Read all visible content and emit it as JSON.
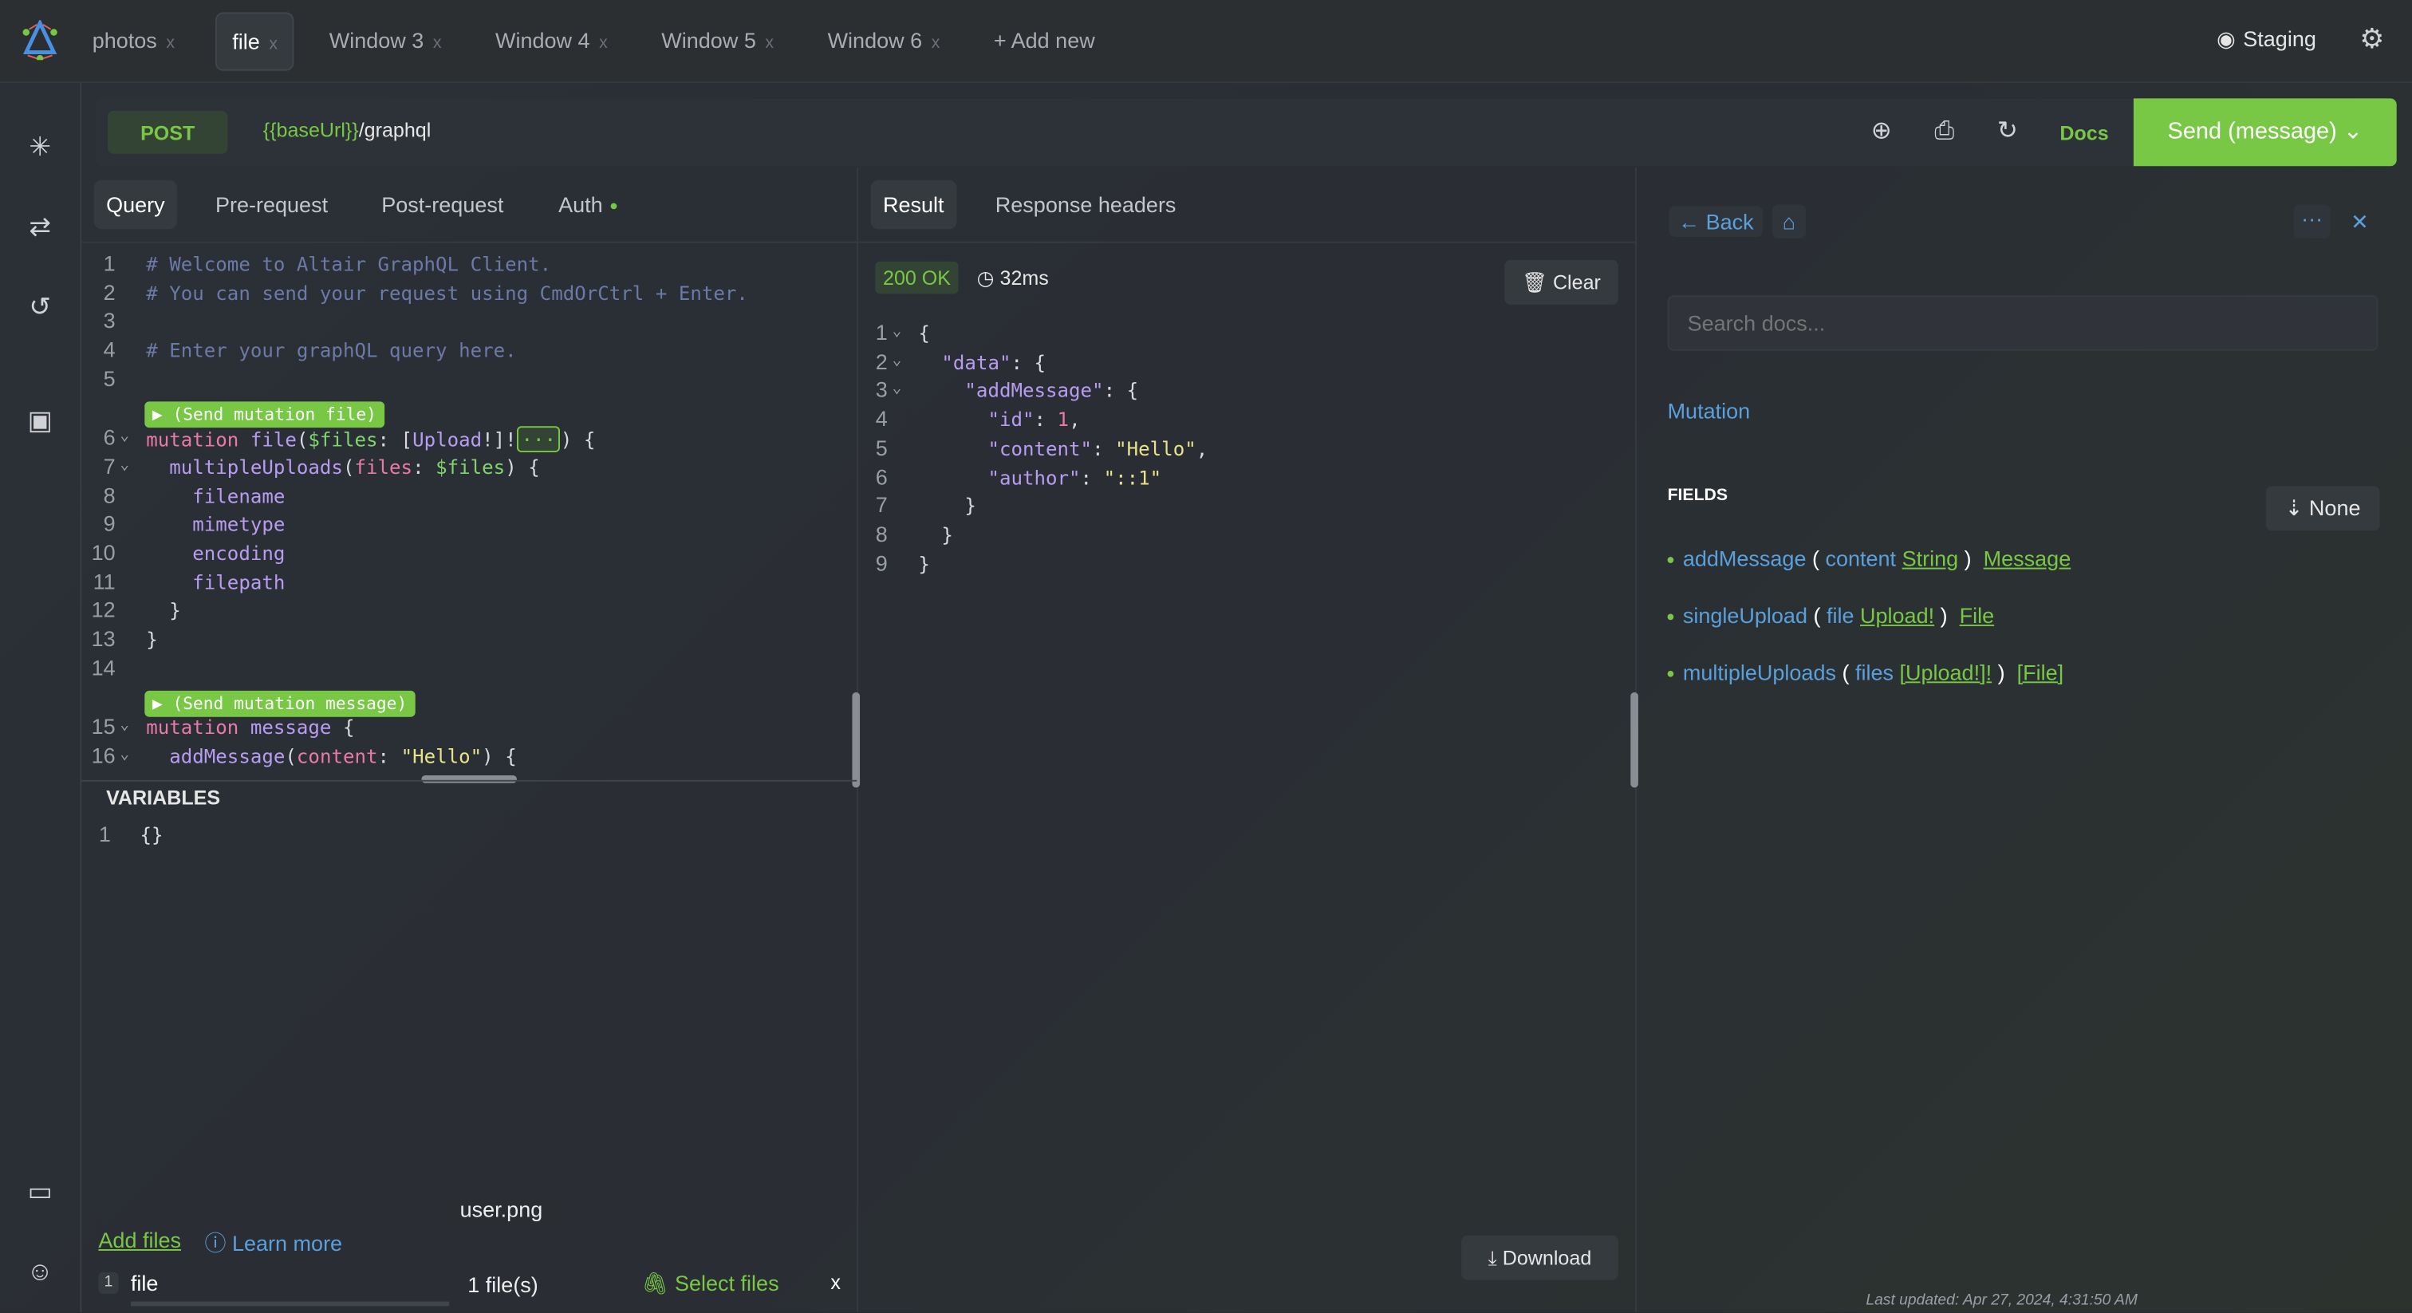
{
  "tabs": [
    {
      "label": "photos",
      "active": false
    },
    {
      "label": "file",
      "active": true
    },
    {
      "label": "Window 3",
      "active": false
    },
    {
      "label": "Window 4",
      "active": false
    },
    {
      "label": "Window 5",
      "active": false
    },
    {
      "label": "Window 6",
      "active": false
    }
  ],
  "tab_close": "x",
  "add_new": "+ Add new",
  "environment": "Staging",
  "request": {
    "method": "POST",
    "url_var": "{{baseUrl}}",
    "url_path": "/graphql",
    "docs": "Docs",
    "send": "Send (message)"
  },
  "query_tabs": [
    "Query",
    "Pre-request",
    "Post-request",
    "Auth"
  ],
  "result_tabs": [
    "Result",
    "Response headers"
  ],
  "query_lines": [
    {
      "n": "1",
      "toks": [
        [
          "# Welcome to Altair GraphQL Client.",
          "c"
        ]
      ]
    },
    {
      "n": "2",
      "toks": [
        [
          "# You can send your request using CmdOrCtrl + Enter.",
          "c"
        ]
      ]
    },
    {
      "n": "3",
      "toks": []
    },
    {
      "n": "4",
      "toks": [
        [
          "# Enter your graphQL query here.",
          "c"
        ]
      ]
    },
    {
      "n": "5",
      "toks": []
    },
    {
      "n": "6",
      "fold": true,
      "toks": [
        [
          "mutation ",
          "k"
        ],
        [
          "file",
          "f"
        ],
        [
          "(",
          "p"
        ],
        [
          "$files",
          "g"
        ],
        [
          ": [",
          "p"
        ],
        [
          "Upload",
          "t"
        ],
        [
          "!]!",
          "p"
        ],
        [
          "ELL",
          "e"
        ],
        [
          ") {",
          "p"
        ]
      ]
    },
    {
      "n": "7",
      "fold": true,
      "toks": [
        [
          "  multipleUploads",
          "f"
        ],
        [
          "(",
          "p"
        ],
        [
          "files",
          "k"
        ],
        [
          ": ",
          "p"
        ],
        [
          "$files",
          "g"
        ],
        [
          ") {",
          "p"
        ]
      ]
    },
    {
      "n": "8",
      "toks": [
        [
          "    filename",
          "f"
        ]
      ]
    },
    {
      "n": "9",
      "toks": [
        [
          "    mimetype",
          "f"
        ]
      ]
    },
    {
      "n": "10",
      "toks": [
        [
          "    encoding",
          "f"
        ]
      ]
    },
    {
      "n": "11",
      "toks": [
        [
          "    filepath",
          "f"
        ]
      ]
    },
    {
      "n": "12",
      "toks": [
        [
          "  }",
          "p"
        ]
      ]
    },
    {
      "n": "13",
      "toks": [
        [
          "}",
          "p"
        ]
      ]
    },
    {
      "n": "14",
      "toks": []
    },
    {
      "n": "15",
      "fold": true,
      "toks": [
        [
          "mutation ",
          "k"
        ],
        [
          "message ",
          "f"
        ],
        [
          "{",
          "p"
        ]
      ]
    },
    {
      "n": "16",
      "fold": true,
      "toks": [
        [
          "  addMessage",
          "f"
        ],
        [
          "(",
          "p"
        ],
        [
          "content",
          "k"
        ],
        [
          ": ",
          "p"
        ],
        [
          "\"Hello\"",
          "s"
        ],
        [
          ") {",
          "p"
        ]
      ]
    }
  ],
  "ellipsis": "···",
  "run_buttons": [
    "▶ (Send mutation file)",
    "▶ (Send mutation message)"
  ],
  "variables": {
    "title": "VARIABLES",
    "line_no": "1",
    "value": "{}"
  },
  "files": {
    "add_files": "Add files",
    "learn_more": "Learn more",
    "index": "1",
    "name": "file",
    "tooltip": "user.png",
    "count": "1 file(s)",
    "select": "Select files",
    "remove": "x"
  },
  "result": {
    "status": "200 OK",
    "time": "32ms",
    "clear": "Clear",
    "download": "Download",
    "lines": [
      {
        "n": "1",
        "fold": true,
        "toks": [
          [
            "{",
            "p"
          ]
        ]
      },
      {
        "n": "2",
        "fold": true,
        "toks": [
          [
            "  \"data\"",
            "f"
          ],
          [
            ": {",
            "p"
          ]
        ]
      },
      {
        "n": "3",
        "fold": true,
        "toks": [
          [
            "    \"addMessage\"",
            "f"
          ],
          [
            ": {",
            "p"
          ]
        ]
      },
      {
        "n": "4",
        "toks": [
          [
            "      \"id\"",
            "f"
          ],
          [
            ": ",
            "p"
          ],
          [
            "1",
            "k"
          ],
          [
            ",",
            "p"
          ]
        ]
      },
      {
        "n": "5",
        "toks": [
          [
            "      \"content\"",
            "f"
          ],
          [
            ": ",
            "p"
          ],
          [
            "\"Hello\"",
            "s"
          ],
          [
            ",",
            "p"
          ]
        ]
      },
      {
        "n": "6",
        "toks": [
          [
            "      \"author\"",
            "f"
          ],
          [
            ": ",
            "p"
          ],
          [
            "\"::1\"",
            "s"
          ]
        ]
      },
      {
        "n": "7",
        "toks": [
          [
            "    }",
            "p"
          ]
        ]
      },
      {
        "n": "8",
        "toks": [
          [
            "  }",
            "p"
          ]
        ]
      },
      {
        "n": "9",
        "toks": [
          [
            "}",
            "p"
          ]
        ]
      }
    ]
  },
  "docs": {
    "back": "Back",
    "search_placeholder": "Search docs...",
    "type": "Mutation",
    "fields_title": "FIELDS",
    "sort": "None",
    "fields": [
      {
        "name": "addMessage",
        "arg": "content",
        "arg_type": "String",
        "ret": "Message"
      },
      {
        "name": "singleUpload",
        "arg": "file",
        "arg_type": "Upload!",
        "ret": "File"
      },
      {
        "name": "multipleUploads",
        "arg": "files",
        "arg_type": "[Upload!]!",
        "ret": "[File]"
      }
    ],
    "last_updated": "Last updated: Apr 27, 2024, 4:31:50 AM"
  },
  "colors": {
    "accent": "#78c846",
    "link": "#5aa0dc"
  }
}
